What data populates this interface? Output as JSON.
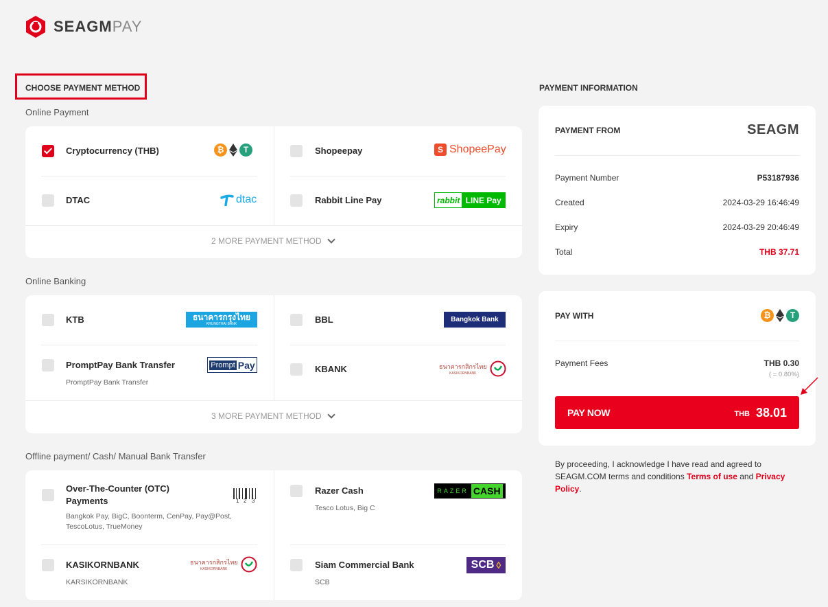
{
  "brand": {
    "name": "SEAGM",
    "suffix": "PAY"
  },
  "left": {
    "title": "CHOOSE PAYMENT METHOD",
    "online_payment": {
      "title": "Online Payment",
      "options": [
        {
          "label": "Cryptocurrency (THB)",
          "checked": true
        },
        {
          "label": "Shopeepay",
          "logo": "ShopeePay"
        },
        {
          "label": "DTAC",
          "logo": "dtac"
        },
        {
          "label": "Rabbit Line Pay",
          "logo_a": "rabbit",
          "logo_b": "LINE Pay"
        }
      ],
      "more": "2 MORE PAYMENT METHOD"
    },
    "online_banking": {
      "title": "Online Banking",
      "options": [
        {
          "label": "KTB",
          "logo": "ธนาคารกรุงไทย",
          "logo_sub": "KRUNGTHAI BANK"
        },
        {
          "label": "BBL",
          "logo": "Bangkok Bank"
        },
        {
          "label": "PromptPay Bank Transfer",
          "sub": "PromptPay Bank Transfer",
          "logo_a": "Prompt",
          "logo_b": "Pay"
        },
        {
          "label": "KBANK",
          "logo": "ธนาคารกสิกรไทย",
          "logo_sub": "KASIKORNBANK"
        }
      ],
      "more": "3 MORE PAYMENT METHOD"
    },
    "offline": {
      "title": "Offline payment/ Cash/ Manual Bank Transfer",
      "options": [
        {
          "label_1": "Over-The-Counter (OTC)",
          "label_2": "Payments",
          "sub_1": "Bangkok Pay, BigC, Boonterm, CenPay, Pay@Post,",
          "sub_2": "TescoLotus, TrueMoney"
        },
        {
          "label": "Razer Cash",
          "sub": "Tesco Lotus, Big C",
          "logo_a": "RAZER",
          "logo_b": "CASH"
        },
        {
          "label": "KASIKORNBANK",
          "sub": "KARSIKORNBANK",
          "logo": "ธนาคารกสิกรไทย",
          "logo_sub": "KASIKORNBANK"
        },
        {
          "label": "Siam Commercial Bank",
          "sub": "SCB",
          "logo": "SCB"
        }
      ]
    }
  },
  "right": {
    "title": "PAYMENT INFORMATION",
    "from_title": "PAYMENT FROM",
    "merchant_logo": "SEAGM",
    "rows": [
      {
        "label": "Payment Number",
        "value": "P53187936"
      },
      {
        "label": "Created",
        "value": "2024-03-29 16:46:49"
      },
      {
        "label": "Expiry",
        "value": "2024-03-29 20:46:49"
      },
      {
        "label": "Total",
        "value": "THB 37.71"
      }
    ],
    "pay_with": "PAY WITH",
    "fees_label": "Payment Fees",
    "fees_value": "THB 0.30",
    "fees_pct": "( = 0.80%)",
    "pay_now": {
      "label": "PAY NOW",
      "currency": "THB",
      "amount": "38.01"
    },
    "agreement": {
      "text_1": "By proceeding, I acknowledge I have read and agreed to SEAGM.COM terms and conditions ",
      "terms": "Terms of use",
      "and": " and ",
      "privacy": "Privacy Policy",
      "end": "."
    }
  },
  "colors": {
    "accent": "#e8001c",
    "background": "#f3f3f3",
    "card": "#ffffff"
  },
  "icons": [
    "seagm-logo-icon",
    "bitcoin-icon",
    "ethereum-icon",
    "tether-icon",
    "chevron-down-icon",
    "arrow-annotation-icon"
  ]
}
